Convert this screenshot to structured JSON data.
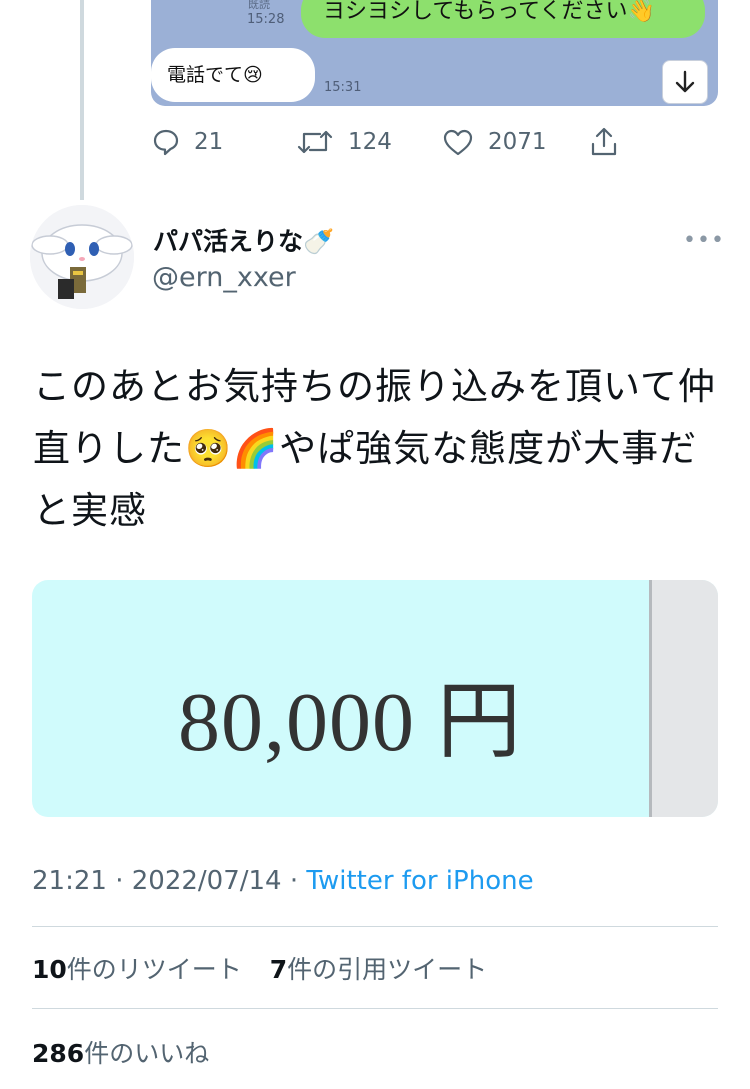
{
  "chat": {
    "read_label": "既読",
    "time_1": "15:28",
    "green_message": "ヨシヨシしてもらってください👋",
    "white_message": "電話でて😢",
    "time_2": "15:31",
    "scroll_icon": "arrow-down-icon"
  },
  "prev_tweet_actions": {
    "replies": "21",
    "retweets": "124",
    "likes": "2071"
  },
  "author": {
    "display_name": "パパ活えりな🍼",
    "handle": "@ern_xxer",
    "more_label": "•••"
  },
  "tweet": {
    "text": "このあとお気持ちの振り込みを頂いて仲直りした🥺🌈やぱ強気な態度が大事だと実感",
    "image_amount": "80,000 円"
  },
  "meta": {
    "time": "21:21",
    "separator": " · ",
    "date": "2022/07/14",
    "source": "Twitter for iPhone"
  },
  "stats": {
    "retweets_count": "10",
    "retweets_label": "件のリツイート",
    "quotes_count": "7",
    "quotes_label": "件の引用ツイート",
    "likes_count": "286",
    "likes_label": "件のいいね"
  },
  "colors": {
    "accent": "#1d9bf0",
    "chat_bg": "#9bb0d6",
    "bubble_green": "#8de06d",
    "image_bg": "#d0fbfc"
  }
}
